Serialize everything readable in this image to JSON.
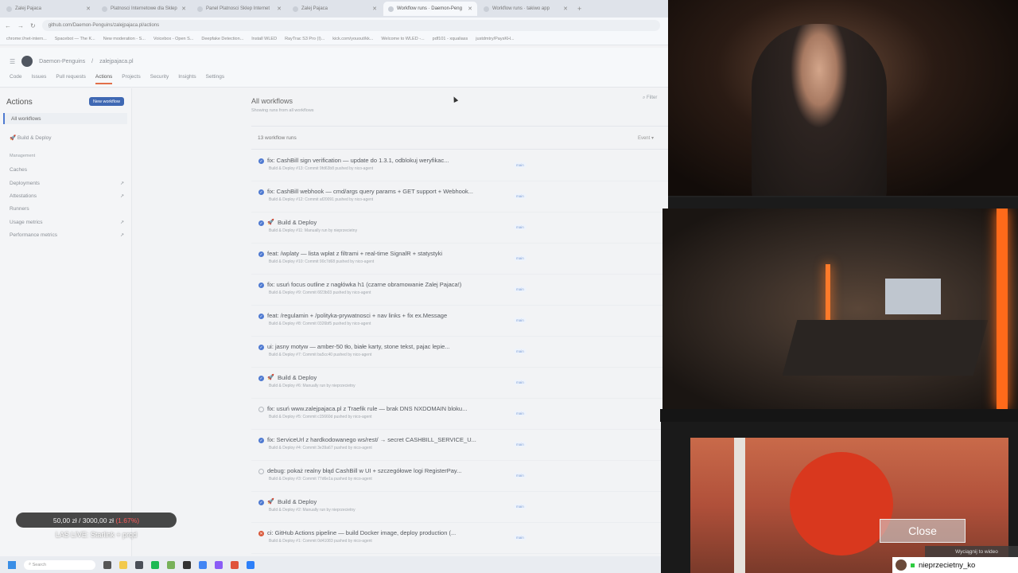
{
  "browser": {
    "tabs": [
      {
        "label": "Zalej Pajaca"
      },
      {
        "label": "Platnosci Internetowe dla Sklep"
      },
      {
        "label": "Panel Platnosci Sklep Internet"
      },
      {
        "label": "Zalej Pajaca"
      },
      {
        "label": "Workflow runs · Daemon-Peng"
      },
      {
        "label": "Workflow runs · takiwo app"
      }
    ],
    "url": "github.com/Daemon-Penguins/zalejpajaca.pl/actions",
    "bookmarks": [
      "chrome://net-intern...",
      "Spacebot — The K...",
      "New moderation - S...",
      "Voicebox - Open S...",
      "Deepfake Detection...",
      "Install WLED",
      "RayTrac S3 Pro (I)...",
      "kick.com/youout/kk...",
      "Welcome to WLED -...",
      "pdf101 - xqualiass",
      "justdmtry/PaysKH..."
    ]
  },
  "github": {
    "owner": "Daemon-Penguins",
    "repo": "zalejpajaca.pl",
    "nav": [
      "Code",
      "Issues",
      "Pull requests",
      "Actions",
      "Projects",
      "Security",
      "Insights",
      "Settings"
    ],
    "active_nav": "Actions"
  },
  "sidebar": {
    "title": "Actions",
    "new_workflow": "New workflow",
    "all_workflows": "All workflows",
    "workflow": "Build & Deploy",
    "management_label": "Management",
    "management": [
      {
        "label": "Caches",
        "ext": ""
      },
      {
        "label": "Deployments",
        "ext": "↗"
      },
      {
        "label": "Attestations",
        "ext": "↗"
      },
      {
        "label": "Runners",
        "ext": ""
      },
      {
        "label": "Usage metrics",
        "ext": "↗"
      },
      {
        "label": "Performance metrics",
        "ext": "↗"
      }
    ]
  },
  "main": {
    "title": "All workflows",
    "subtitle": "Showing runs from all workflows",
    "filter_placeholder": "Filter",
    "runs_count": "13 workflow runs",
    "event_label": "Event ▾",
    "runs": [
      {
        "title": "fix: CashBill sign verification — update do 1.3.1, odblokuj weryfikac...",
        "meta": "Build & Deploy #13: Commit 9fd63b8 pushed by nico-agent",
        "status": "success",
        "rocket": false
      },
      {
        "title": "fix: CashBill webhook — cmd/args query params + GET support + Webhook...",
        "meta": "Build & Deploy #12: Commit af20091 pushed by nico-agent",
        "status": "success",
        "rocket": false
      },
      {
        "title": "Build & Deploy",
        "meta": "Build & Deploy #11: Manually run by nieprzecietny",
        "status": "success",
        "rocket": true
      },
      {
        "title": "feat: /wplaty — lista wpłat z filtrami + real-time SignalR + statystyki",
        "meta": "Build & Deploy #10: Commit 90c7d68 pushed by nico-agent",
        "status": "success",
        "rocket": false
      },
      {
        "title": "fix: usuń focus outline z nagłówka h1 (czarne obramowanie Zalej Pajaca!)",
        "meta": "Build & Deploy #9: Commit 6f23b03 pushed by nico-agent",
        "status": "success",
        "rocket": false
      },
      {
        "title": "feat: /regulamin + /polityka-prywatnosci + nav links + fix ex.Message",
        "meta": "Build & Deploy #8: Commit 0326bf5 pushed by nico-agent",
        "status": "success",
        "rocket": false
      },
      {
        "title": "ui: jasny motyw — amber-50 tło, białe karty, stone tekst, pajac lepie...",
        "meta": "Build & Deploy #7: Commit ba5cc40 pushed by nico-agent",
        "status": "success",
        "rocket": false
      },
      {
        "title": "Build & Deploy",
        "meta": "Build & Deploy #6: Manually run by nieprzecietny",
        "status": "success",
        "rocket": true
      },
      {
        "title": "fix: usuń www.zalejpajaca.pl z Traefik rule — brak DNS NXDOMAIN bloku...",
        "meta": "Build & Deploy #5: Commit c15660d pushed by nico-agent",
        "status": "skipped",
        "rocket": false
      },
      {
        "title": "fix: ServiceUrl z hardkodowanego ws/rest/ → secret CASHBILL_SERVICE_U...",
        "meta": "Build & Deploy #4: Commit 3e39a67 pushed by nico-agent",
        "status": "success",
        "rocket": false
      },
      {
        "title": "debug: pokaż realny błąd CashBill w UI + szczegółowe logi RegisterPay...",
        "meta": "Build & Deploy #3: Commit 77d6e1a pushed by nico-agent",
        "status": "skipped",
        "rocket": false
      },
      {
        "title": "Build & Deploy",
        "meta": "Build & Deploy #2: Manually run by nieprzecietny",
        "status": "success",
        "rocket": true
      },
      {
        "title": "ci: GitHub Actions pipeline — build Docker image, deploy production (...",
        "meta": "Build & Deploy #1: Commit 0d41083 pushed by nico-agent",
        "status": "failure",
        "rocket": false
      }
    ],
    "branch_label": "main"
  },
  "overlay": {
    "donation": "50,00 zł  /  3000,00 zł",
    "donation_pct": "(1.67%)",
    "live_label": "LAS LIVE: Starlink + prqd"
  },
  "taskbar": {
    "search": "Search"
  },
  "player": {
    "close": "Close",
    "pip": "Wyciągnij to wideo"
  },
  "stream": {
    "username": "nieprzecietny_ko"
  },
  "colors": {
    "accent": "#4f7ad1",
    "failure": "#d9583a",
    "brand": "#e2704a"
  }
}
